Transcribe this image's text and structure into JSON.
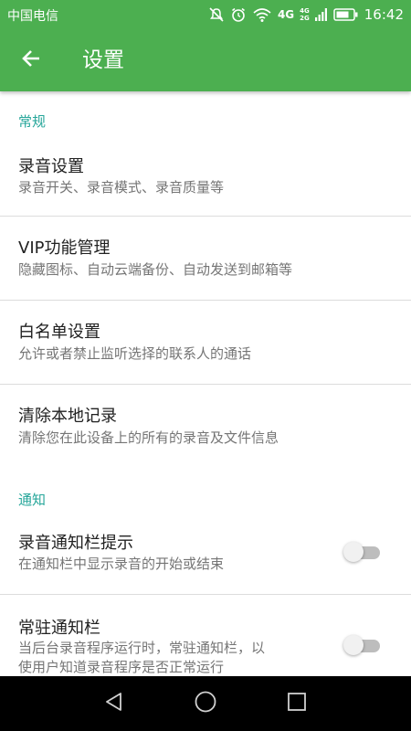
{
  "status_bar": {
    "carrier": "中国电信",
    "network_label": "4G",
    "network_small_top": "4G",
    "network_small_bottom": "2G",
    "time": "16:42",
    "icons": [
      "mute-icon",
      "alarm-icon",
      "wifi-icon",
      "signal-icon",
      "battery-icon"
    ]
  },
  "app_bar": {
    "title": "设置",
    "back_icon": "back-arrow-icon"
  },
  "sections": {
    "general": {
      "header": "常规",
      "items": [
        {
          "title": "录音设置",
          "subtitle": "录音开关、录音模式、录音质量等"
        },
        {
          "title": "VIP功能管理",
          "subtitle": "隐藏图标、自动云端备份、自动发送到邮箱等"
        },
        {
          "title": "白名单设置",
          "subtitle": "允许或者禁止监听选择的联系人的通话"
        },
        {
          "title": "清除本地记录",
          "subtitle": "清除您在此设备上的所有的录音及文件信息"
        }
      ]
    },
    "notification": {
      "header": "通知",
      "items": [
        {
          "title": "录音通知栏提示",
          "subtitle": "在通知栏中显示录音的开始或结束",
          "enabled": false
        },
        {
          "title": "常驻通知栏",
          "subtitle_line1": "当后台录音程序运行时，常驻通知栏，以",
          "subtitle_line2": "使用户知道录音程序是否正常运行",
          "enabled": false
        }
      ]
    }
  },
  "nav_bar": {
    "icons": [
      "back-triangle-icon",
      "home-circle-icon",
      "recents-square-icon"
    ]
  },
  "colors": {
    "primary": "#4caf50",
    "accent": "#26a69a",
    "title_text": "#212121",
    "subtitle_text": "#757575"
  }
}
